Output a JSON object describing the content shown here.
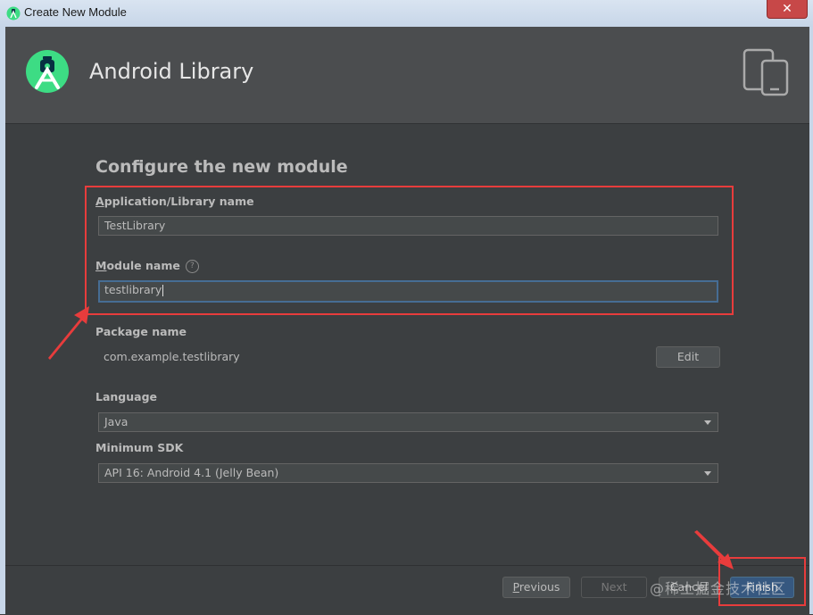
{
  "window": {
    "title": "Create New Module",
    "close_glyph": "✕"
  },
  "header": {
    "title": "Android Library",
    "logo_icon": "android-studio-icon",
    "device_icon": "phone-tablet-icon"
  },
  "form": {
    "section_title": "Configure the new module",
    "app_name": {
      "label_mnemonic": "A",
      "label_rest": "pplication/Library name",
      "value": "TestLibrary"
    },
    "module_name": {
      "label_mnemonic": "M",
      "label_rest": "odule name",
      "help": "?",
      "value": "testlibrary"
    },
    "package_name": {
      "label": "Package name",
      "value": "com.example.testlibrary",
      "edit_label": "Edit"
    },
    "language": {
      "label": "Language",
      "value": "Java"
    },
    "min_sdk": {
      "label": "Minimum SDK",
      "value": "API 16: Android 4.1 (Jelly Bean)"
    }
  },
  "footer": {
    "previous_mnemonic": "P",
    "previous_rest": "revious",
    "next_label": "Next",
    "cancel_label": "Cancel",
    "finish_label": "Finish"
  },
  "watermark": "@稀土掘金技术社区",
  "colors": {
    "accent": "#365880",
    "annotation": "#e83c3c",
    "focus": "#466d94"
  }
}
